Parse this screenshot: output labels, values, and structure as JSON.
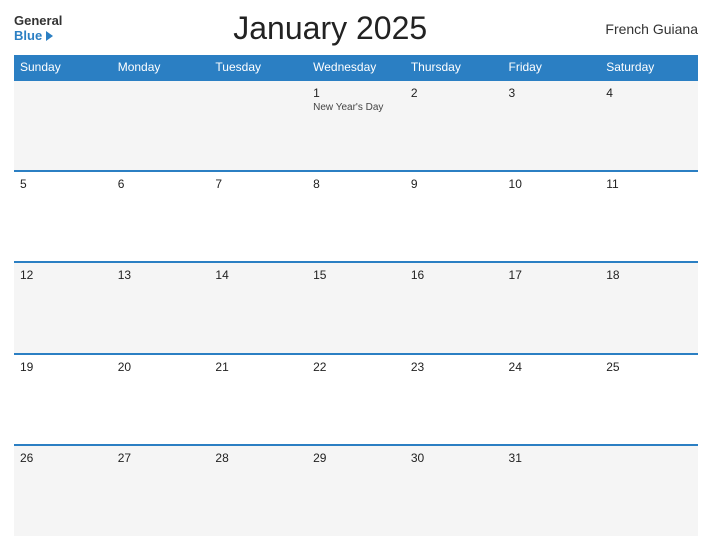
{
  "header": {
    "logo_general": "General",
    "logo_blue": "Blue",
    "title": "January 2025",
    "region": "French Guiana"
  },
  "weekdays": [
    "Sunday",
    "Monday",
    "Tuesday",
    "Wednesday",
    "Thursday",
    "Friday",
    "Saturday"
  ],
  "weeks": [
    [
      {
        "day": "",
        "empty": true
      },
      {
        "day": "",
        "empty": true
      },
      {
        "day": "",
        "empty": true
      },
      {
        "day": "1",
        "event": "New Year's Day"
      },
      {
        "day": "2",
        "event": ""
      },
      {
        "day": "3",
        "event": ""
      },
      {
        "day": "4",
        "event": ""
      }
    ],
    [
      {
        "day": "5",
        "event": ""
      },
      {
        "day": "6",
        "event": ""
      },
      {
        "day": "7",
        "event": ""
      },
      {
        "day": "8",
        "event": ""
      },
      {
        "day": "9",
        "event": ""
      },
      {
        "day": "10",
        "event": ""
      },
      {
        "day": "11",
        "event": ""
      }
    ],
    [
      {
        "day": "12",
        "event": ""
      },
      {
        "day": "13",
        "event": ""
      },
      {
        "day": "14",
        "event": ""
      },
      {
        "day": "15",
        "event": ""
      },
      {
        "day": "16",
        "event": ""
      },
      {
        "day": "17",
        "event": ""
      },
      {
        "day": "18",
        "event": ""
      }
    ],
    [
      {
        "day": "19",
        "event": ""
      },
      {
        "day": "20",
        "event": ""
      },
      {
        "day": "21",
        "event": ""
      },
      {
        "day": "22",
        "event": ""
      },
      {
        "day": "23",
        "event": ""
      },
      {
        "day": "24",
        "event": ""
      },
      {
        "day": "25",
        "event": ""
      }
    ],
    [
      {
        "day": "26",
        "event": ""
      },
      {
        "day": "27",
        "event": ""
      },
      {
        "day": "28",
        "event": ""
      },
      {
        "day": "29",
        "event": ""
      },
      {
        "day": "30",
        "event": ""
      },
      {
        "day": "31",
        "event": ""
      },
      {
        "day": "",
        "empty": true
      }
    ]
  ]
}
